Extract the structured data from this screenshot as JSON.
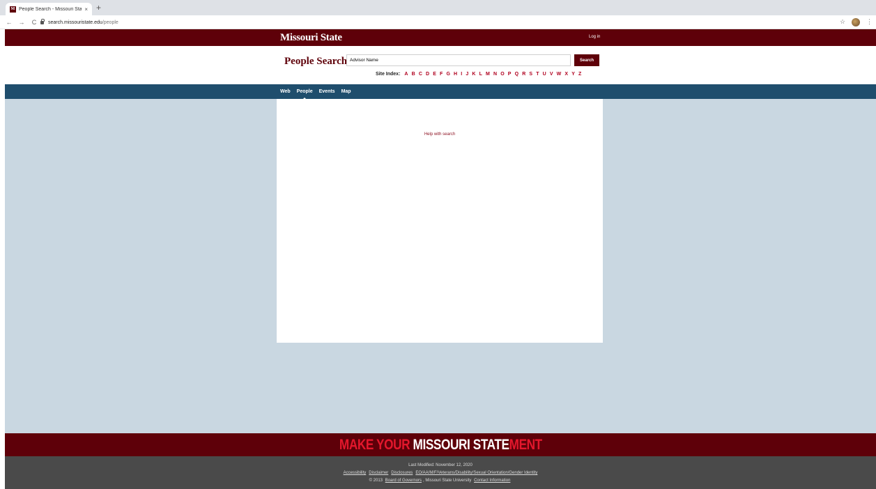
{
  "browser": {
    "tab_title": "People Search - Missouri State",
    "tab_close": "×",
    "new_tab": "+",
    "back": "←",
    "forward": "→",
    "reload": "C",
    "url_host": "search.missouristate.edu",
    "url_path": "/people",
    "star": "☆",
    "menu": "⋮",
    "favicon_letter": "M"
  },
  "header": {
    "brand": "Missouri State",
    "login": "Log in"
  },
  "search": {
    "title": "People Search",
    "input_value": "Advisor Name",
    "button": "Search",
    "site_index_label": "Site Index:",
    "letters": [
      "A",
      "B",
      "C",
      "D",
      "E",
      "F",
      "G",
      "H",
      "I",
      "J",
      "K",
      "L",
      "M",
      "N",
      "O",
      "P",
      "Q",
      "R",
      "S",
      "T",
      "U",
      "V",
      "W",
      "X",
      "Y",
      "Z"
    ]
  },
  "nav": {
    "items": [
      "Web",
      "People",
      "Events",
      "Map"
    ],
    "active": "People"
  },
  "content": {
    "help_link": "Help with search"
  },
  "slogan": {
    "part1": "MAKE YOUR ",
    "part2": "MISSOURI STATE",
    "part3": "MENT"
  },
  "footer": {
    "last_modified": "Last Modified: November 12, 2020",
    "links_line": [
      "Accessibility",
      "Disclaimer",
      "Disclosures",
      "EO/AA/M/F/Veterans/Disability/Sexual Orientation/Gender Identity"
    ],
    "copyright_prefix": "© 2013",
    "board": "Board of Governors",
    "copyright_suffix": ", Missouri State University",
    "contact": "Contact Information"
  },
  "colors": {
    "maroon": "#5e0009",
    "navy": "#1f4e6d",
    "background": "#c9d7e1",
    "accent_red": "#e3172c"
  }
}
